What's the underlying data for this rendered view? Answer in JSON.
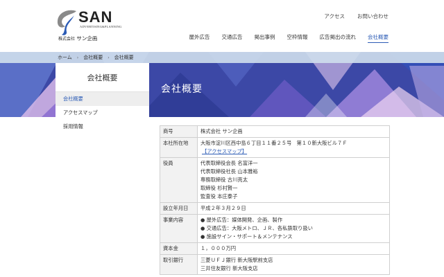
{
  "header": {
    "logo": {
      "brand": "SAN",
      "tagline": "ADVERTISING&PLANNING",
      "company_prefix": "株式会社",
      "company_name": "サン企画"
    },
    "util_nav": [
      "アクセス",
      "お問い合わせ"
    ],
    "main_nav": [
      {
        "label": "屋外広告",
        "active": false
      },
      {
        "label": "交通広告",
        "active": false
      },
      {
        "label": "掲出事例",
        "active": false
      },
      {
        "label": "空枠情報",
        "active": false
      },
      {
        "label": "広告掲出の流れ",
        "active": false
      },
      {
        "label": "会社概要",
        "active": true
      }
    ]
  },
  "breadcrumb": [
    "ホーム",
    "会社概要",
    "会社概要"
  ],
  "page_title": "会社概要",
  "sidebar": {
    "title": "会社概要",
    "items": [
      {
        "label": "会社概要",
        "active": true
      },
      {
        "label": "アクセスマップ",
        "active": false
      },
      {
        "label": "採用情報",
        "active": false
      }
    ]
  },
  "company_info": {
    "rows": [
      {
        "label": "商号",
        "lines": [
          "株式会社 サン企画"
        ]
      },
      {
        "label": "本社所在地",
        "lines": [
          "大阪市淀川区西中島６丁目１１番２５号　第１０新大阪ビル７Ｆ"
        ],
        "link": "【アクセスマップ】"
      },
      {
        "label": "役員",
        "lines": [
          "代表取締役会長 名富洋一",
          "代表取締役社長 山本雅裕",
          "専務取締役 古川亮太",
          "取締役 杉村賢一",
          "監査役 本庄泰子"
        ]
      },
      {
        "label": "設立年月日",
        "lines": [
          "平成２年３月２９日"
        ]
      },
      {
        "label": "事業内容",
        "lines": [
          "● 屋外広告：媒体開発、企画、製作",
          "● 交通広告：大阪メトロ、ＪＲ、各私鉄取り扱い",
          "● 施設サイン・サポート＆メンテナンス"
        ]
      },
      {
        "label": "資本金",
        "lines": [
          "１，０００万円"
        ]
      },
      {
        "label": "取引銀行",
        "lines": [
          "三菱ＵＦＪ銀行 新大阪駅前支店",
          "三井住友銀行 新大阪支店"
        ]
      }
    ]
  },
  "colors": {
    "accent": "#2b5bb5",
    "banner": "#3a4aa8"
  }
}
